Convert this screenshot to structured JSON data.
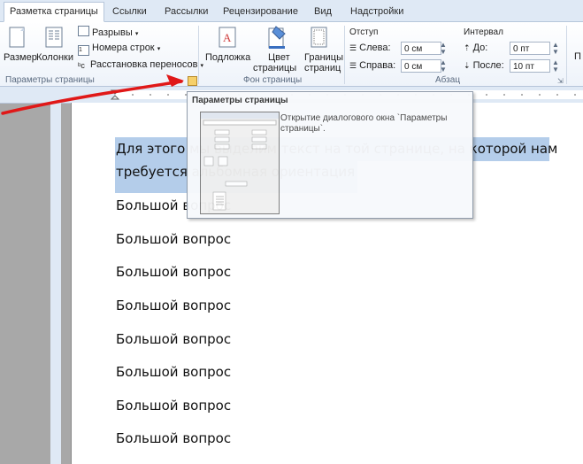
{
  "tabs": [
    "Разметка страницы",
    "Ссылки",
    "Рассылки",
    "Рецензирование",
    "Вид",
    "Надстройки"
  ],
  "ribbon": {
    "page_setup": {
      "size": "Размер",
      "columns": "Колонки",
      "breaks": "Разрывы",
      "line_numbers": "Номера строк",
      "hyphenation": "Расстановка переносов",
      "group_label": "Параметры страницы"
    },
    "background": {
      "watermark": "Подложка",
      "page_color_1": "Цвет",
      "page_color_2": "страницы",
      "borders_1": "Границы",
      "borders_2": "страниц",
      "group_label": "Фон страницы"
    },
    "paragraph": {
      "indent_title": "Отступ",
      "left_label": "Слева:",
      "left_value": "0 см",
      "right_label": "Справа:",
      "right_value": "0 см",
      "spacing_title": "Интервал",
      "before_label": "До:",
      "before_value": "0 пт",
      "after_label": "После:",
      "after_value": "10 пт",
      "group_label": "Абзац"
    },
    "extra": "П"
  },
  "tooltip": {
    "title": "Параметры страницы",
    "description": "Открытие диалогового окна `Параметры страницы`."
  },
  "document": {
    "line1": "Для этого мы выделим текст на той странице, на которой нам",
    "line2": "требуется альбомная ориентация",
    "repeats": [
      "Большой вопрос",
      "Большой вопрос",
      "Большой вопрос",
      "Большой вопрос",
      "Большой вопрос",
      "Большой вопрос",
      "Большой вопрос",
      "Большой вопрос"
    ]
  },
  "colors": {
    "arrow": "#e01818",
    "selection": "#b4cdea",
    "ribbon_bg": "#dfe9f5"
  },
  "icons": [
    "size-icon",
    "columns-icon",
    "breaks-icon",
    "line-numbers-icon",
    "hyphenation-icon",
    "watermark-icon",
    "page-color-icon",
    "page-borders-icon",
    "dialog-launcher-icon"
  ]
}
